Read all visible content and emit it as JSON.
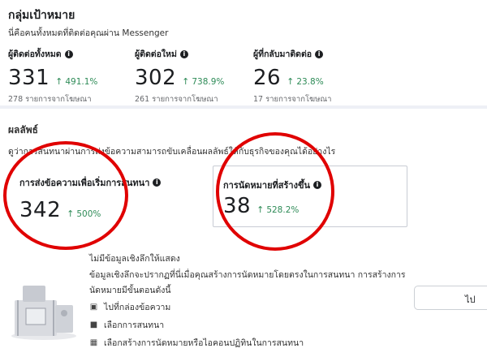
{
  "header": {
    "title": "กลุ่มเป้าหมาย",
    "subtitle": "นี่คือคนทั้งหมดที่ติดต่อคุณผ่าน Messenger"
  },
  "stats": [
    {
      "label": "ผู้ติดต่อทั้งหมด",
      "value": "331",
      "delta": "491.1%",
      "source": "278 รายการจากโฆษณา"
    },
    {
      "label": "ผู้ติดต่อใหม่",
      "value": "302",
      "delta": "738.9%",
      "source": "261 รายการจากโฆษณา"
    },
    {
      "label": "ผู้ที่กลับมาติดต่อ",
      "value": "26",
      "delta": "23.8%",
      "source": "17 รายการจากโฆษณา"
    }
  ],
  "results": {
    "title": "ผลลัพธ์",
    "description": "ดูว่าการสนทนาผ่านการส่งข้อความสามารถขับเคลื่อนผลลัพธ์ให้กับธุรกิจของคุณได้อย่างไร",
    "cards": [
      {
        "label": "การส่งข้อความเพื่อเริ่มการสนทนา",
        "value": "342",
        "delta": "500%"
      },
      {
        "label": "การนัดหมายที่สร้างขึ้น",
        "value": "38",
        "delta": "528.2%"
      }
    ]
  },
  "insights": {
    "no_data": "ไม่มีข้อมูลเชิงลึกให้แสดง",
    "info": "ข้อมูลเชิงลึกจะปรากฏที่นี่เมื่อคุณสร้างการนัดหมายโดยตรงในการสนทนา การสร้างการนัดหมายมีขั้นตอนดังนี้",
    "actions": [
      {
        "icon": "inbox-icon",
        "label": "ไปที่กล่องข้อความ"
      },
      {
        "icon": "chat-icon",
        "label": "เลือกการสนทนา"
      },
      {
        "icon": "calendar-icon",
        "label": "เลือกสร้างการนัดหมายหรือไอคอนปฏิทินในการสนทนา"
      }
    ],
    "button_label": "ไป"
  },
  "colors": {
    "positive": "#2e8b57",
    "annotation": "#e00000",
    "text": "#1c1e21"
  }
}
